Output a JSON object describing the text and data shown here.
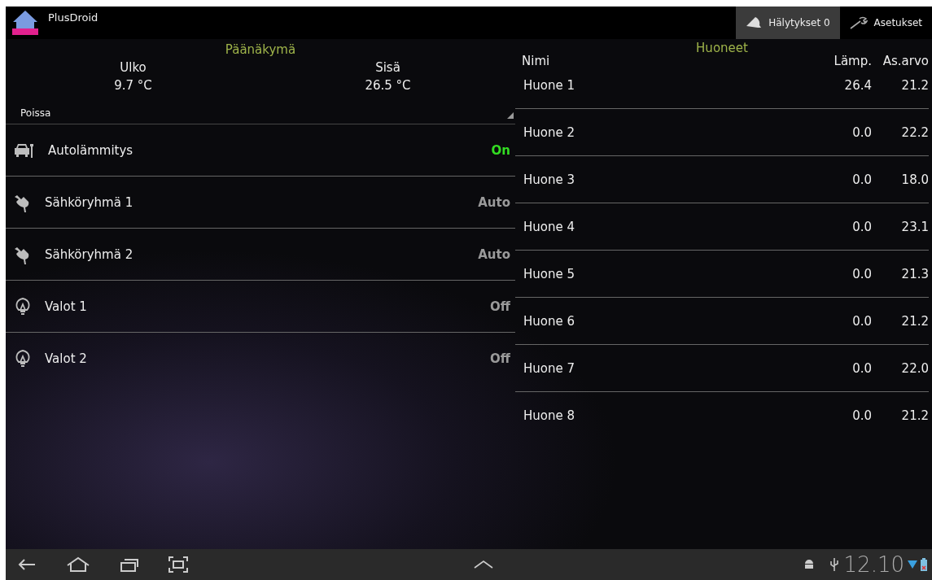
{
  "action_bar": {
    "app_title": "PlusDroid",
    "actions": [
      {
        "kind": "alarm",
        "label": "Hälytykset 0",
        "selected": true
      },
      {
        "kind": "settings",
        "label": "Asetukset",
        "selected": false
      }
    ]
  },
  "main": {
    "title": "Päänäkymä",
    "temperatures": [
      {
        "label": "Ulko",
        "value": "9.7 °C"
      },
      {
        "label": "Sisä",
        "value": "26.5 °C"
      }
    ],
    "mode": {
      "value": "Poissa"
    },
    "devices": [
      {
        "kind": "car",
        "name": "Autolämmitys",
        "state": "On",
        "on": true
      },
      {
        "kind": "plug",
        "name": "Sähköryhmä 1",
        "state": "Auto",
        "on": false
      },
      {
        "kind": "plug",
        "name": "Sähköryhmä 2",
        "state": "Auto",
        "on": false
      },
      {
        "kind": "bulb",
        "name": "Valot 1",
        "state": "Off",
        "on": false
      },
      {
        "kind": "bulb",
        "name": "Valot 2",
        "state": "Off",
        "on": false
      }
    ]
  },
  "rooms": {
    "title": "Huoneet",
    "columns": [
      "Nimi",
      "Lämp.",
      "As.arvo"
    ],
    "rows": [
      {
        "name": "Huone 1",
        "temp": "26.4",
        "setpoint": "21.2"
      },
      {
        "name": "Huone 2",
        "temp": "0.0",
        "setpoint": "22.2"
      },
      {
        "name": "Huone 3",
        "temp": "0.0",
        "setpoint": "18.0"
      },
      {
        "name": "Huone 4",
        "temp": "0.0",
        "setpoint": "23.1"
      },
      {
        "name": "Huone 5",
        "temp": "0.0",
        "setpoint": "21.3"
      },
      {
        "name": "Huone 6",
        "temp": "0.0",
        "setpoint": "21.2"
      },
      {
        "name": "Huone 7",
        "temp": "0.0",
        "setpoint": "22.0"
      },
      {
        "name": "Huone 8",
        "temp": "0.0",
        "setpoint": "21.2"
      }
    ]
  },
  "status_bar": {
    "time": "12.10"
  }
}
